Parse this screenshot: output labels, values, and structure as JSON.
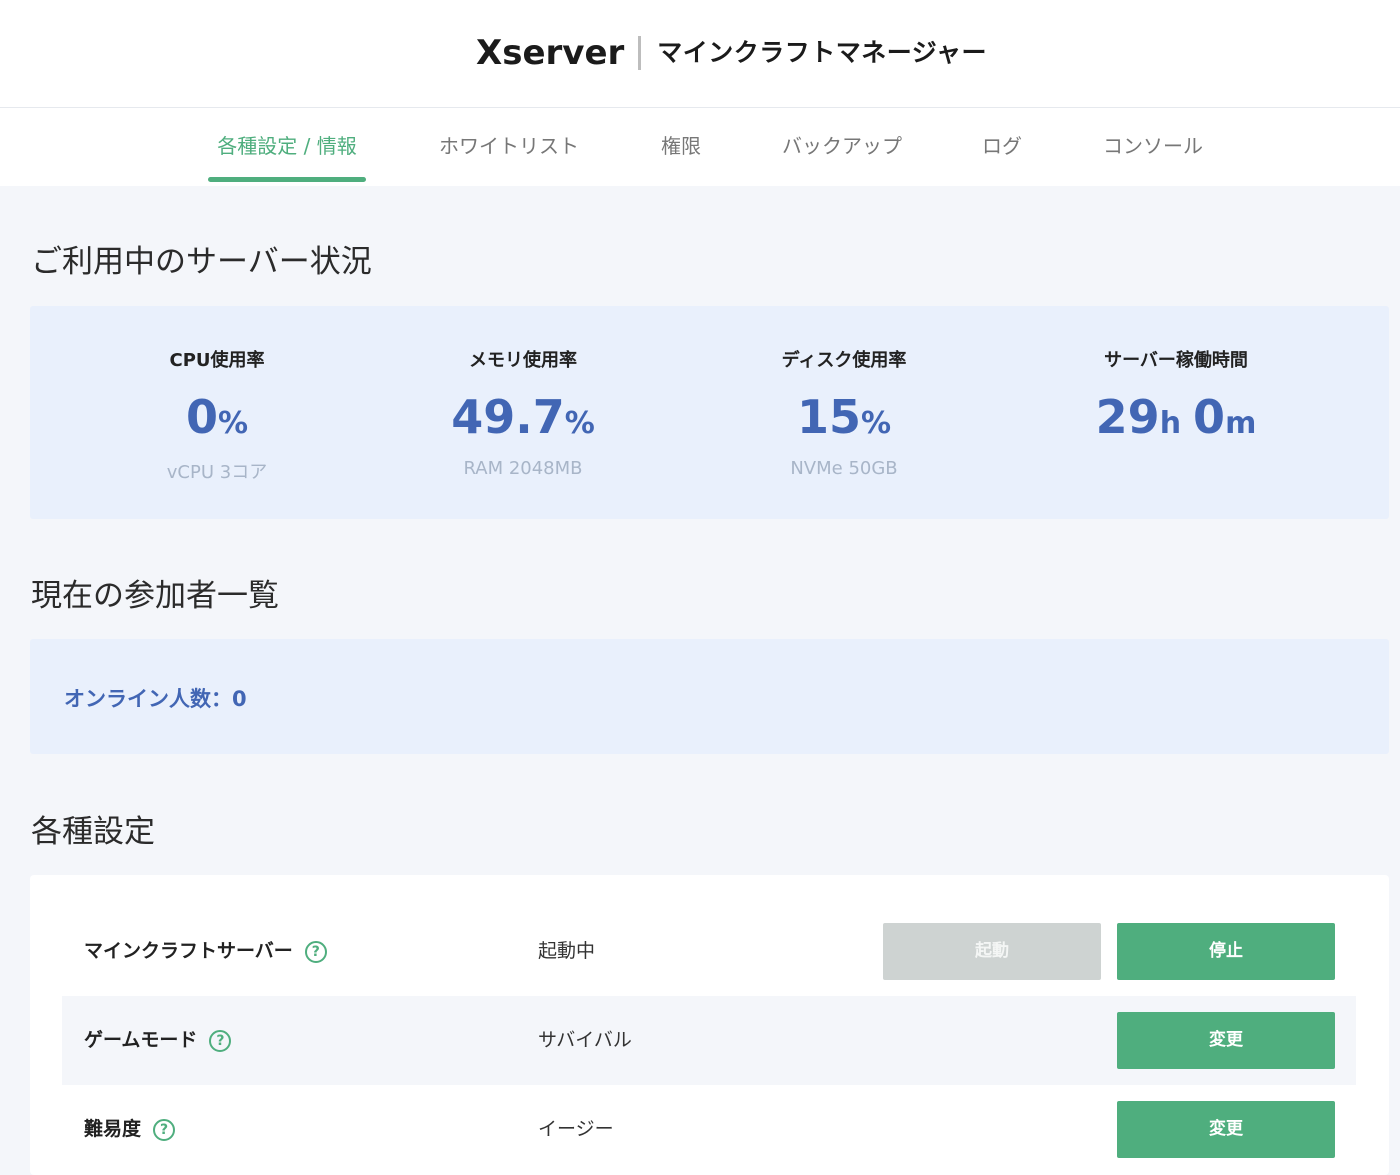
{
  "header": {
    "logo": "Xserver",
    "subtitle": "マインクラフトマネージャー"
  },
  "tabs": [
    {
      "label": "各種設定 / 情報",
      "active": true
    },
    {
      "label": "ホワイトリスト",
      "active": false
    },
    {
      "label": "権限",
      "active": false
    },
    {
      "label": "バックアップ",
      "active": false
    },
    {
      "label": "ログ",
      "active": false
    },
    {
      "label": "コンソール",
      "active": false
    }
  ],
  "server_status": {
    "title": "ご利用中のサーバー状況",
    "stats": [
      {
        "label": "CPU使用率",
        "value": "0",
        "unit": "%",
        "sub": "vCPU 3コア"
      },
      {
        "label": "メモリ使用率",
        "value": "49.7",
        "unit": "%",
        "sub": "RAM 2048MB"
      },
      {
        "label": "ディスク使用率",
        "value": "15",
        "unit": "%",
        "sub": "NVMe 50GB"
      },
      {
        "label": "サーバー稼働時間",
        "hours": "29",
        "hours_unit": "h",
        "minutes": "0",
        "minutes_unit": "m"
      }
    ]
  },
  "participants": {
    "title": "現在の参加者一覧",
    "online_label": "オンライン人数：0"
  },
  "settings": {
    "title": "各種設定",
    "rows": [
      {
        "label": "マインクラフトサーバー",
        "value": "起動中",
        "start_button": "起動",
        "stop_button": "停止"
      },
      {
        "label": "ゲームモード",
        "value": "サバイバル",
        "change_button": "変更"
      },
      {
        "label": "難易度",
        "value": "イージー",
        "change_button": "変更"
      }
    ],
    "help_glyph": "?"
  },
  "colors": {
    "accent_green": "#4fae7e",
    "stat_blue": "#4266b4",
    "panel_bg": "#e9f0fc"
  }
}
